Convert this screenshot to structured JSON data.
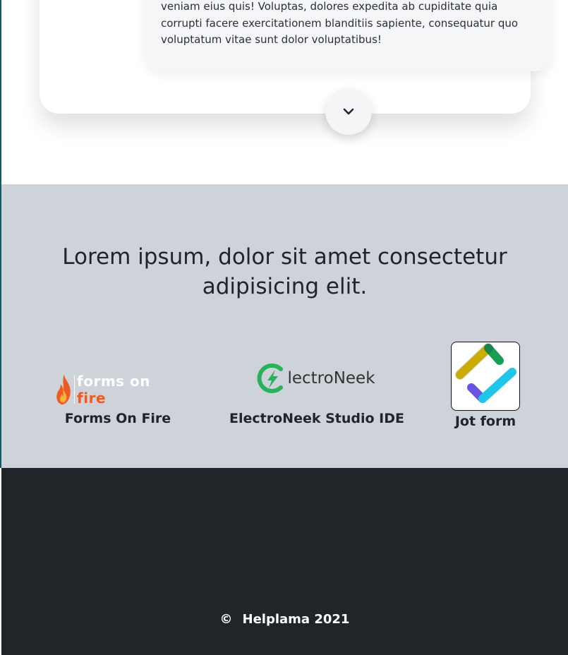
{
  "testimonial": {
    "text": "veniam eius quis! Voluptas, dolores expedita ab cupiditate quia corrupti facere exercitationem blanditiis sapiente, consequatur quo voluptatum vitae sunt dolor voluptatibus!",
    "expand_icon": "chevron-down-icon"
  },
  "partners": {
    "heading": "Lorem ipsum, dolor sit amet consectetur adipisicing elit.",
    "items": [
      {
        "logo_text_a": "forms on ",
        "logo_text_b": "fire",
        "name": "Forms On Fire"
      },
      {
        "logo_text": "lectroNeek",
        "name": "ElectroNeek Studio IDE"
      },
      {
        "name": "Jot form"
      }
    ]
  },
  "footer": {
    "copyright_symbol": "©",
    "copyright_text": "Helplama 2021"
  },
  "colors": {
    "partners_bg": "#ced2d9",
    "footer_bg": "#212529",
    "fire_orange": "#f05a22",
    "electroneek_green": "#27b35b"
  }
}
